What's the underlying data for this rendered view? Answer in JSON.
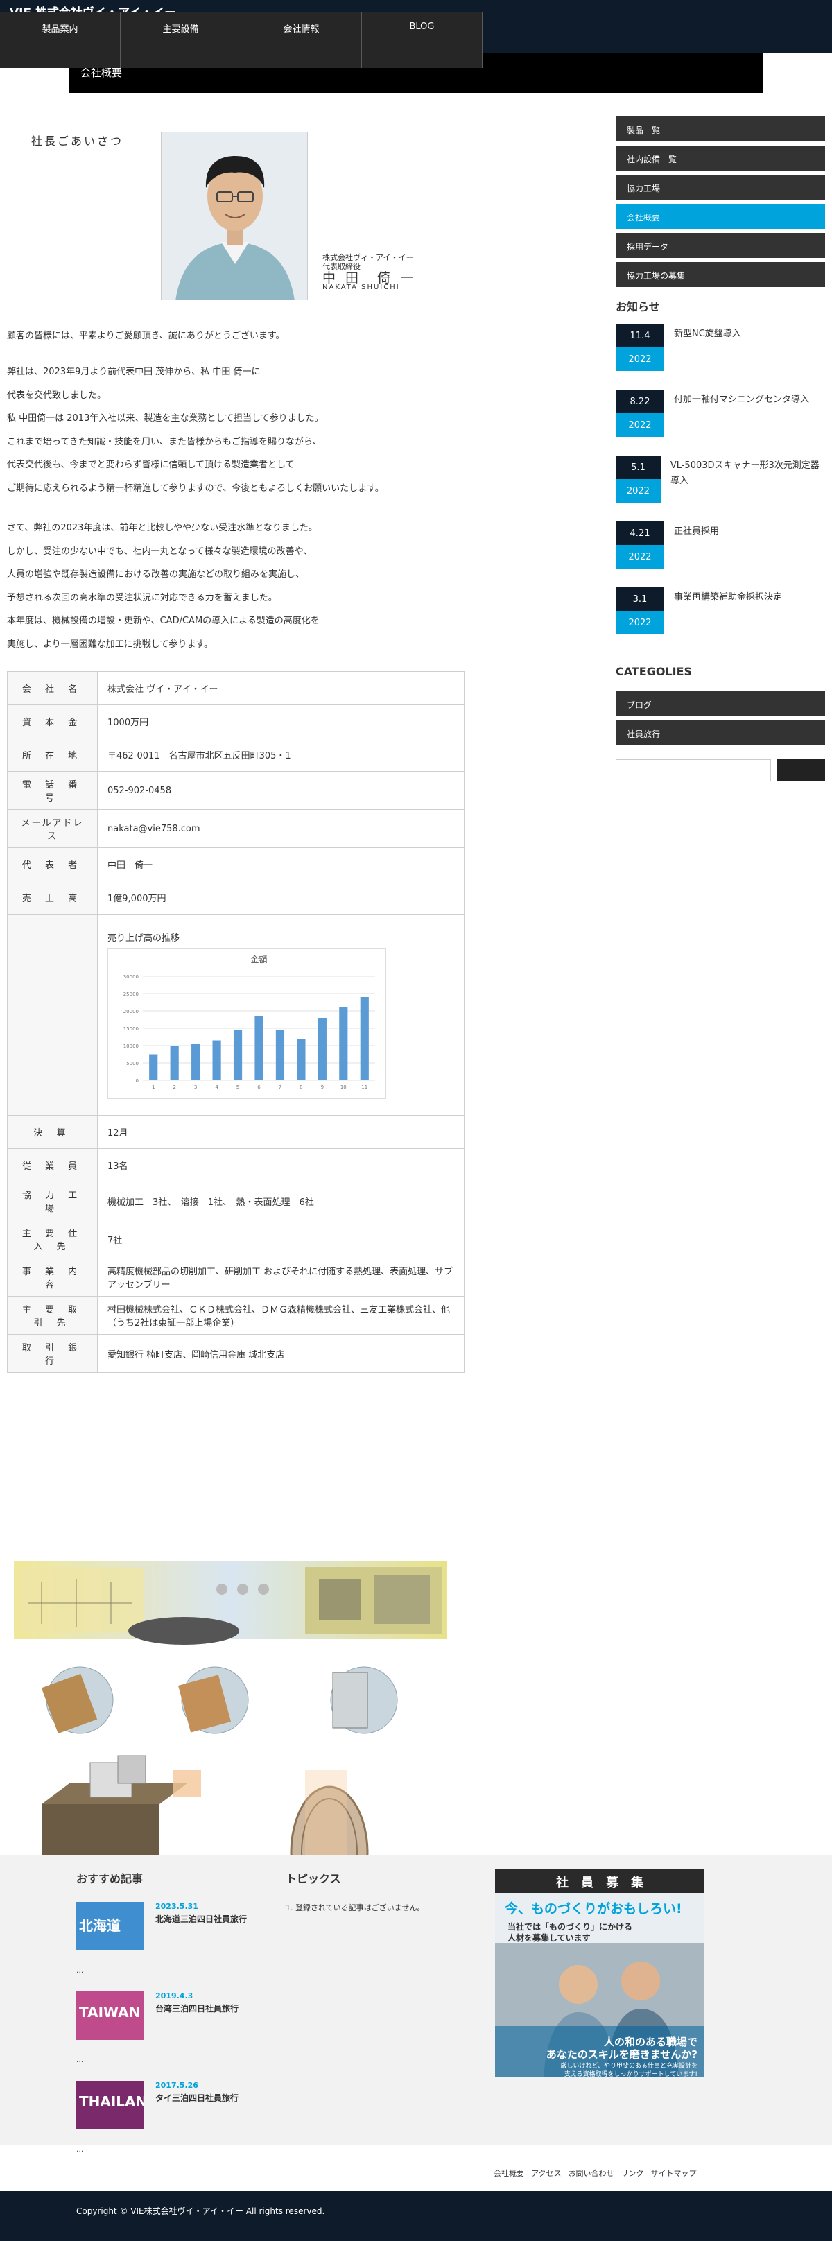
{
  "site": {
    "title": "VIE 株式会社ヴイ・アイ・イー"
  },
  "nav": [
    "製品案内",
    "主要設備",
    "会社情報",
    "BLOG"
  ],
  "page_bar": "会社概要",
  "greeting": {
    "heading": "社長ごあいさつ",
    "company": "株式会社ヴィ・アイ・イー",
    "role": "代表取締役",
    "name": "中 田　倚 一",
    "name_en": "NAKATA SHUICHI",
    "p1": [
      "顧客の皆様には、平素よりご愛顧頂き、誠にありがとうございます。"
    ],
    "p2": [
      "弊社は、2023年9月より前代表中田 茂伸から、私 中田 倚一に",
      "代表を交代致しました。",
      "私 中田倚一は 2013年入社以来、製造を主な業務として担当して参りました。",
      "これまで培ってきた知識・技能を用い、また皆様からもご指導を賜りながら、",
      "代表交代後も、今までと変わらず皆様に信頼して頂ける製造業者として",
      "ご期待に応えられるよう精一杯精進して参りますので、今後ともよろしくお願いいたします。"
    ],
    "p3": [
      "さて、弊社の2023年度は、前年と比較しやや少ない受注水準となりました。",
      "しかし、受注の少ない中でも、社内一丸となって様々な製造環境の改善や、",
      "人員の増強や既存製造設備における改善の実施などの取り組みを実施し、",
      "予想される次回の高水準の受注状況に対応できる力を蓄えました。",
      "本年度は、機械設備の増設・更新や、CAD/CAMの導入による製造の高度化を",
      "実施し、より一層困難な加工に挑戦して参ります。"
    ]
  },
  "company_info": [
    {
      "k": "会 社 名",
      "v": "株式会社 ヴイ・アイ・イー"
    },
    {
      "k": "資 本 金",
      "v": "1000万円"
    },
    {
      "k": "所 在 地",
      "v": "〒462-0011　名古屋市北区五反田町305・1"
    },
    {
      "k": "電 話 番 号",
      "v": "052-902-0458"
    },
    {
      "k": "メールアドレス",
      "v": "nakata@vie758.com"
    },
    {
      "k": "代 表 者",
      "v": "中田　倚一"
    },
    {
      "k": "売 上 高",
      "v": "1億9,000万円"
    }
  ],
  "chart_caption": "売り上げ高の推移",
  "chart_data": {
    "type": "bar",
    "title": "金額",
    "categories": [
      "1",
      "2",
      "3",
      "4",
      "5",
      "6",
      "7",
      "8",
      "9",
      "10",
      "11"
    ],
    "values": [
      7500,
      10000,
      10500,
      11500,
      14500,
      18500,
      14500,
      12000,
      18000,
      21000,
      24000
    ],
    "ylim": [
      0,
      30000
    ],
    "yticks": [
      0,
      5000,
      10000,
      15000,
      20000,
      25000,
      30000
    ],
    "color": "#5b9bd5",
    "grid": true
  },
  "company_info2": [
    {
      "k": "決 算",
      "v": "12月"
    },
    {
      "k": "従 業 員",
      "v": "13名"
    },
    {
      "k": "協 力 工 場",
      "v": "機械加工　3社、　溶接　1社、　熱・表面処理　6社"
    },
    {
      "k": "主 要 仕 入 先",
      "v": "7社"
    },
    {
      "k": "事 業 内 容",
      "v": "高精度機械部品の切削加工、研削加工 およびそれに付随する熱処理、表面処理、サブアッセンブリー"
    },
    {
      "k": "主 要 取 引 先",
      "v": "村田機械株式会社、ＣＫＤ株式会社、ＤＭＧ森精機株式会社、三友工業株式会社、他（うち2社は東証一部上場企業）"
    },
    {
      "k": "取 引 銀 行",
      "v": "愛知銀行 楠町支店、岡崎信用金庫 城北支店"
    }
  ],
  "side_menu": [
    "製品一覧",
    "社内設備一覧",
    "協力工場",
    "会社概要",
    "採用データ",
    "協力工場の募集"
  ],
  "side_active": 3,
  "news_heading": "お知らせ",
  "news": [
    {
      "d": "11.4",
      "y": "2022",
      "t": "新型NC旋盤導入"
    },
    {
      "d": "8.22",
      "y": "2022",
      "t": "付加一軸付マシニングセンタ導入"
    },
    {
      "d": "5.1",
      "y": "2022",
      "t": "VL-5003Dスキャナー形3次元測定器導入"
    },
    {
      "d": "4.21",
      "y": "2022",
      "t": "正社員採用"
    },
    {
      "d": "3.1",
      "y": "2022",
      "t": "事業再構築補助金採択決定"
    }
  ],
  "cat_heading": "CATEGOLIES",
  "categories": [
    "ブログ",
    "社員旅行"
  ],
  "footer": {
    "rec_heading": "おすすめ記事",
    "recs": [
      {
        "date": "2023.5.31",
        "title": "北海道三泊四日社員旅行",
        "thumb": "北海道",
        "more": "..."
      },
      {
        "date": "2019.4.3",
        "title": "台湾三泊四日社員旅行",
        "thumb": "TAIWAN",
        "more": "..."
      },
      {
        "date": "2017.5.26",
        "title": "タイ三泊四日社員旅行",
        "thumb": "THAILAN",
        "more": "..."
      }
    ],
    "topics_heading": "トピックス",
    "topics_empty": "1. 登録されている記事はございません。",
    "banner": {
      "title": "社　員　募　集",
      "catch": "今、ものづくりがおもしろい!",
      "sub1": "当社では「ものづくり」にかける",
      "sub2": "人材を募集しています",
      "foot1": "人の和のある職場で",
      "foot2": "あなたのスキルを磨きませんか?",
      "foot3": "厳しいけれど、やり甲斐のある仕事と充実設計を",
      "foot4": "支える資格取得をしっかりサポートしています!"
    },
    "links": [
      "会社概要",
      "アクセス",
      "お問い合わせ",
      "リンク",
      "サイトマップ"
    ],
    "copyright": "Copyright © VIE株式会社ヴイ・アイ・イー All rights reserved."
  }
}
